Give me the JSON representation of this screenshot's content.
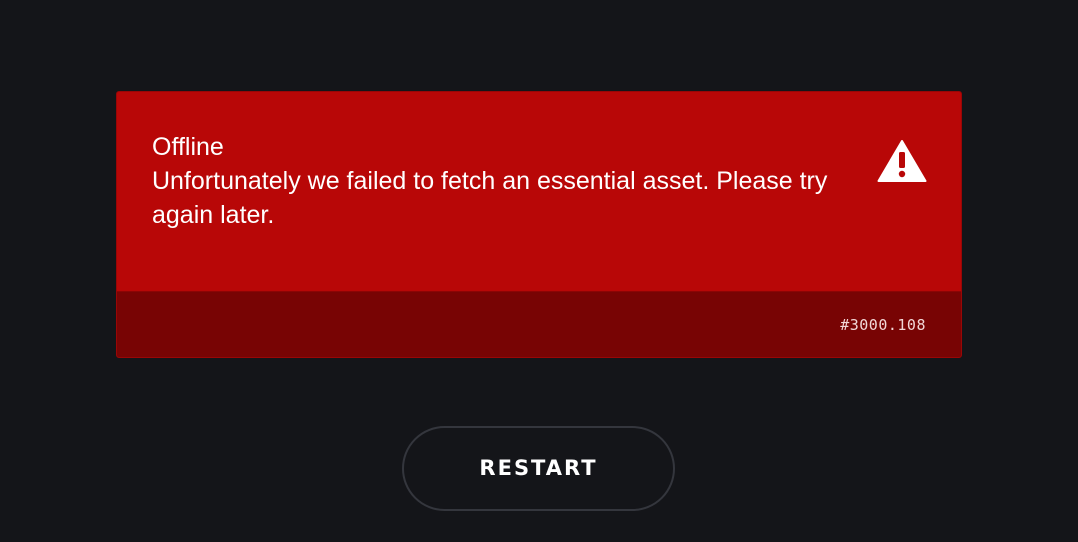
{
  "error": {
    "title": "Offline",
    "message": "Unfortunately we failed to fetch an essential asset. Please try again later.",
    "code": "#3000.108",
    "icon": "warning-triangle-icon",
    "colors": {
      "card": "#b80707",
      "footer": "#780404",
      "background": "#141519"
    }
  },
  "actions": {
    "restart_label": "RESTART"
  }
}
